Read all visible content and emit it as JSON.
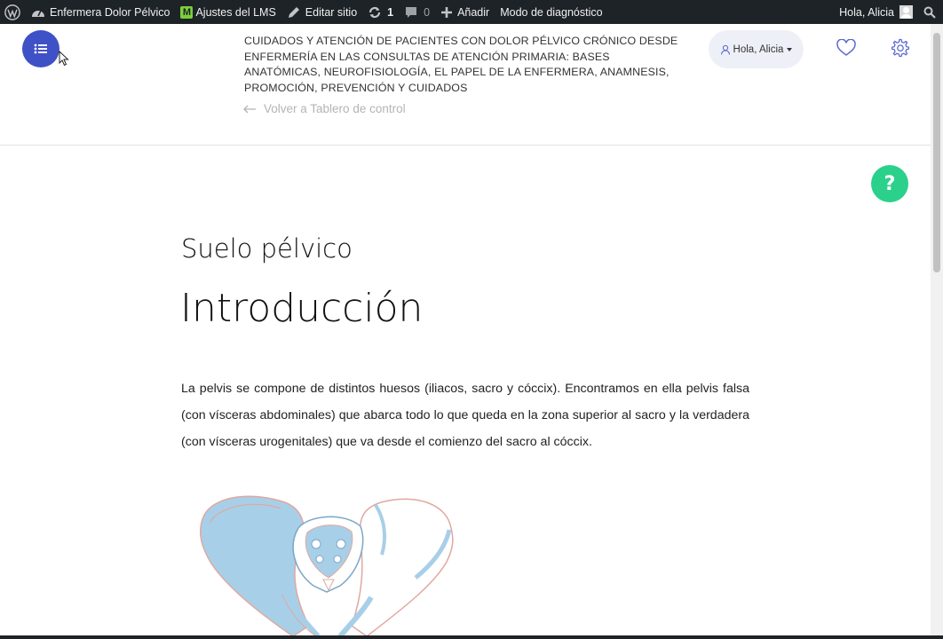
{
  "admin_bar": {
    "site_name": "Enfermera Dolor Pélvico",
    "lms_settings": "Ajustes del LMS",
    "lms_letter": "M",
    "edit_site": "Editar sitio",
    "updates_count": "1",
    "comments_count": "0",
    "add_new": "Añadir",
    "diagnostic_mode": "Modo de diagnóstico",
    "greeting": "Hola, Alicia"
  },
  "header": {
    "course_title": "CUIDADOS Y ATENCIÓN DE PACIENTES CON DOLOR PÉLVICO CRÓNICO DESDE ENFERMERÍA EN LAS CONSULTAS DE ATENCIÓN PRIMARIA: BASES ANATÓMICAS, NEUROFISIOLOGÍA, EL PAPEL DE LA ENFERMERA, ANAMNESIS, PROMOCIÓN, PREVENCIÓN Y CUIDADOS",
    "back_link": "Volver a Tablero de control",
    "user_greeting": "Hola, Alicia"
  },
  "help_button": "?",
  "lesson": {
    "section": "Suelo pélvico",
    "title": "Introducción",
    "paragraph": "La pelvis se compone de distintos huesos (iliacos, sacro y cóccix). Encontramos en ella pelvis falsa (con vísceras abdominales) que abarca todo lo que queda en la zona superior al sacro y la verdadera (con vísceras urogenitales) que va desde el comienzo del sacro al cóccix."
  },
  "colors": {
    "admin_bar": "#1d2327",
    "menu_button": "#3f51c6",
    "help_button": "#2bd18b",
    "icon_accent": "#5b6ad0",
    "pelvis_fill": "#a8cfe8",
    "pelvis_outline": "#e0a8a0"
  },
  "icons": {
    "wp_logo": "wordpress-icon",
    "dashboard": "dashboard-icon",
    "edit": "edit-icon",
    "updates": "updates-icon",
    "comments": "comment-icon",
    "add": "plus-icon",
    "search": "search-icon",
    "menu": "list-icon",
    "back": "arrow-left-icon",
    "user": "user-icon",
    "favorite": "heart-icon",
    "settings": "gear-icon"
  }
}
